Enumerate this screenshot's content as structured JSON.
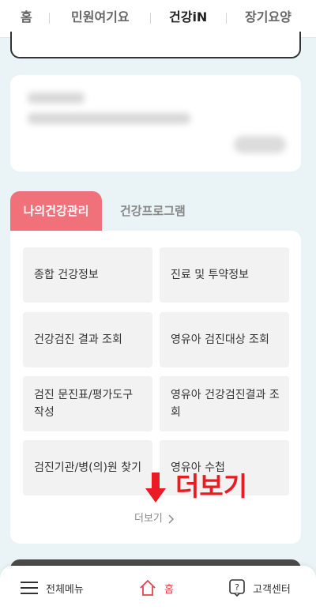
{
  "top_tabs": [
    "홈",
    "민원여기요",
    "건강iN",
    "장기요양"
  ],
  "health_tabs": {
    "active": "나의건강관리",
    "other": "건강프로그램"
  },
  "tiles": [
    {
      "label": "종합 건강정보"
    },
    {
      "label": "진료 및 투약정보"
    },
    {
      "label": "건강검진 결과 조회"
    },
    {
      "label": "영유아 검진대상 조회"
    },
    {
      "label": "검진 문진표/평가도구 작성"
    },
    {
      "label": "영유아 건강검진결과 조회"
    },
    {
      "label": "검진기관/병(의)원 찾기"
    },
    {
      "label": "영유아 수첩"
    }
  ],
  "more_overlay": "더보기",
  "more_link": "더보기",
  "bottom_nav": {
    "menu": "전체메뉴",
    "home": "홈",
    "support": "고객센터"
  },
  "colors": {
    "accent": "#f1717a",
    "annotation": "#ea1b22",
    "home_active": "#e8434c"
  },
  "icons": [
    "hamburger-menu-icon",
    "home-icon",
    "help-icon",
    "down-arrow-icon",
    "chevron-right-icon"
  ]
}
